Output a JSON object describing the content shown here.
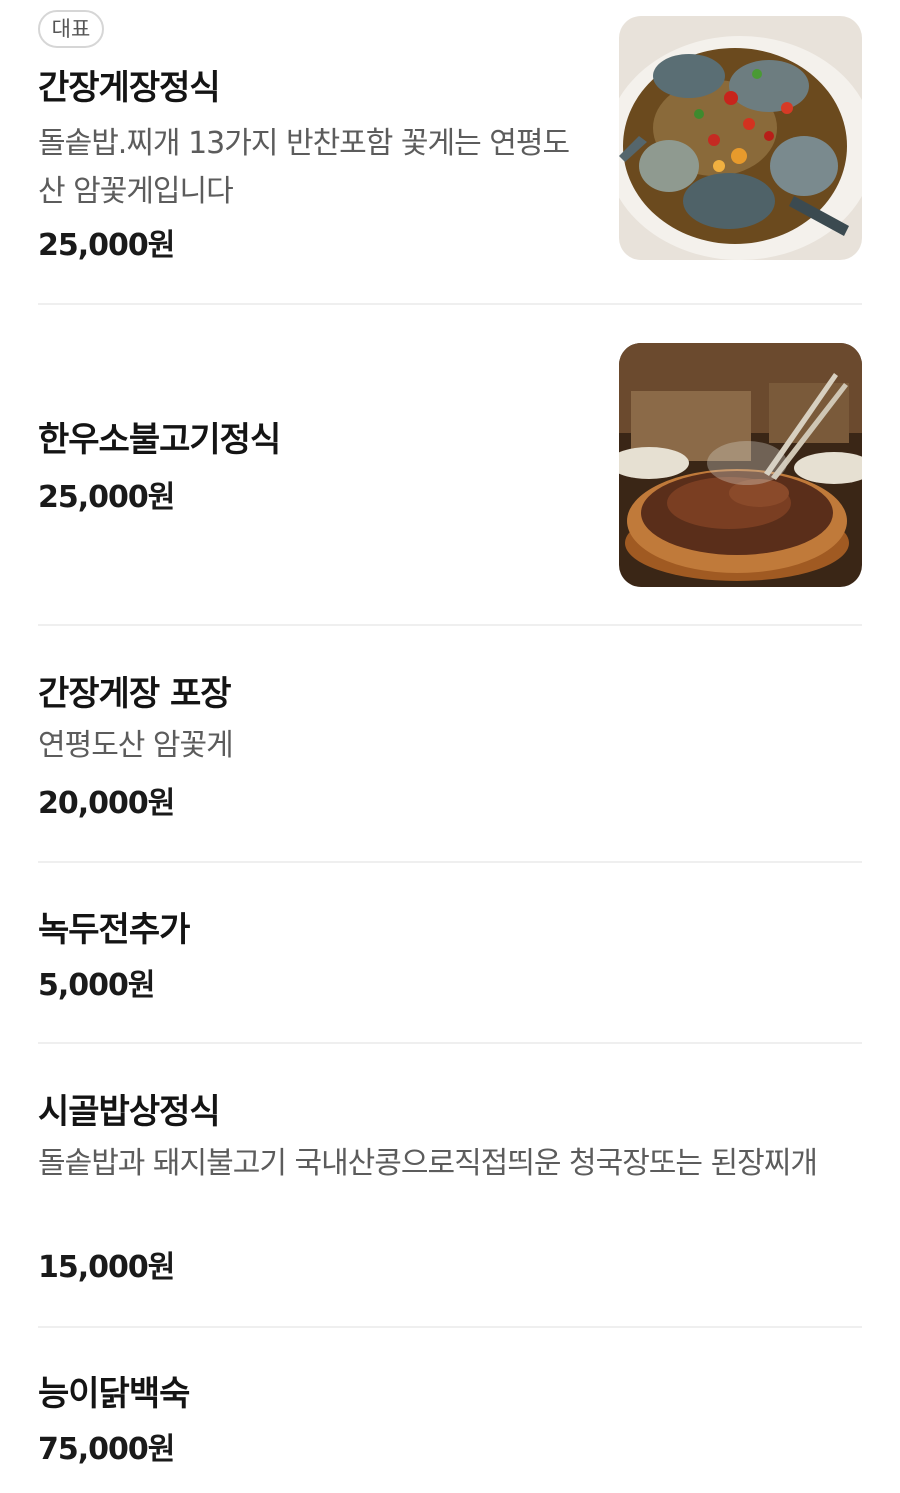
{
  "menu": [
    {
      "badge": "대표",
      "name": "간장게장정식",
      "description": "돌솥밥.찌개 13가지 반찬포함 꽃게는 연평도산 암꽃게입니다",
      "price": "25,000원",
      "image": "soy-sauce-crab-photo"
    },
    {
      "name": "한우소불고기정식",
      "price": "25,000원",
      "image": "beef-bulgogi-photo"
    },
    {
      "name": "간장게장 포장",
      "description": "연평도산 암꽃게",
      "price": "20,000원"
    },
    {
      "name": "녹두전추가",
      "price": "5,000원"
    },
    {
      "name": "시골밥상정식",
      "description": "돌솥밥과 돼지불고기 국내산콩으로직접띄운 청국장또는 된장찌개",
      "price": "15,000원"
    },
    {
      "name": "능이닭백숙",
      "price": "75,000원"
    }
  ]
}
